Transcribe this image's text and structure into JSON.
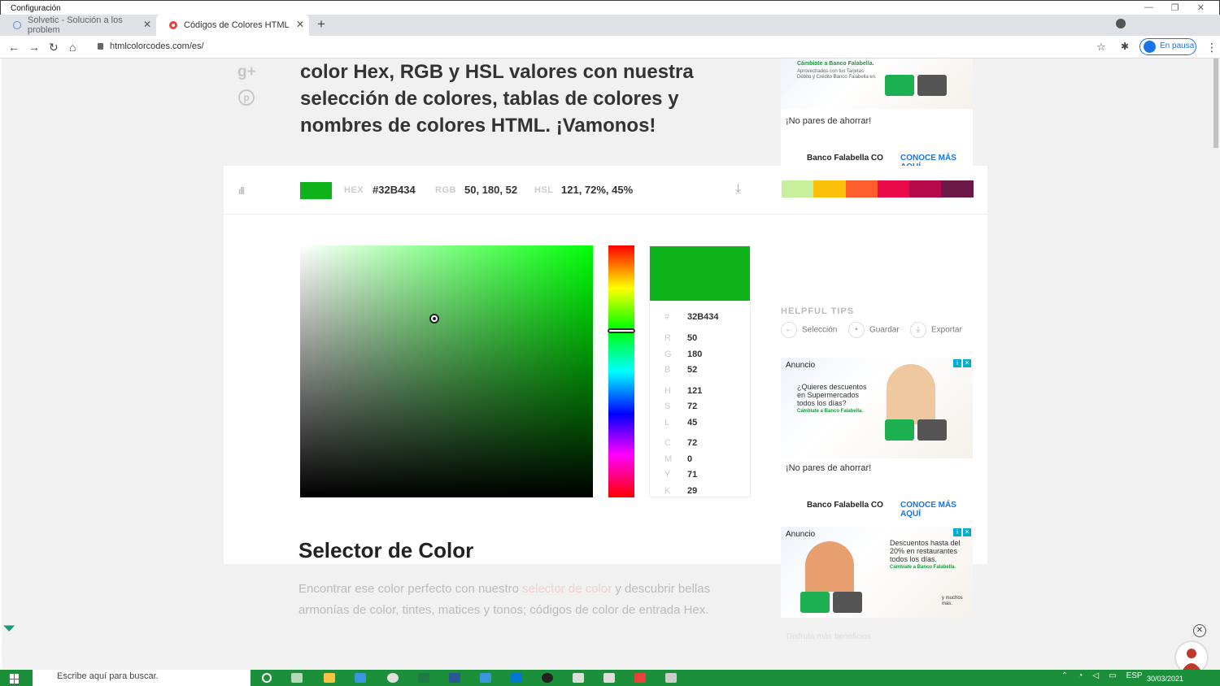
{
  "window": {
    "title": "Configuración"
  },
  "tabs": [
    {
      "label": "Solvetic - Solución a los problem"
    },
    {
      "label": "Códigos de Colores HTML"
    }
  ],
  "address": {
    "url": "htmlcolorcodes.com/es/"
  },
  "profile": {
    "label": "En pausa"
  },
  "page": {
    "headline_lines": [
      "color Hex, RGB y HSL valores con nuestra",
      "selección de colores, tablas de colores y",
      "nombres de colores HTML. ¡Vamonos!"
    ]
  },
  "color_bar": {
    "hex_label": "HEX",
    "hex_value": "#32B434",
    "rgb_label": "RGB",
    "rgb_value": "50, 180, 52",
    "hsl_label": "HSL",
    "hsl_value": "121, 72%, 45%",
    "swatch": "#0fb31b",
    "palette": [
      "#c6f09c",
      "#fcc20b",
      "#fe5d2e",
      "#ea0a49",
      "#b40a4a",
      "#6b1747"
    ]
  },
  "picker": {
    "hue_level": 0.34,
    "values": [
      {
        "k": "#",
        "v": "32B434"
      },
      {
        "k": "R",
        "v": "50"
      },
      {
        "k": "G",
        "v": "180"
      },
      {
        "k": "B",
        "v": "52"
      },
      {
        "k": "H",
        "v": "121"
      },
      {
        "k": "S",
        "v": "72"
      },
      {
        "k": "L",
        "v": "45"
      },
      {
        "k": "C",
        "v": "72"
      },
      {
        "k": "M",
        "v": "0"
      },
      {
        "k": "Y",
        "v": "71"
      },
      {
        "k": "K",
        "v": "29"
      }
    ]
  },
  "tips": {
    "title": "HELPFUL TIPS",
    "items": [
      "Selección",
      "Guardar",
      "Exportar"
    ]
  },
  "ads": {
    "top": {
      "tagline": "¡No pares de ahorrar!",
      "brand": "Banco Falabella CO",
      "cta": "CONOCE MÁS AQUÍ",
      "small1": "Cámbiate a Banco Falabella.",
      "small2": "Aprovechados con tus Tarjetas",
      "small3": "Débito y Crédito Banco Falabella en."
    },
    "mid": {
      "anuncio": "Anuncio",
      "headline": "¿Quieres descuentos en Supermercados todos los días?",
      "small": "Cámbiate a Banco Falabella.",
      "tagline": "¡No pares de ahorrar!",
      "brand": "Banco Falabella CO",
      "cta": "CONOCE MÁS AQUÍ"
    },
    "bottom": {
      "anuncio": "Anuncio",
      "headline": "Descuentos hasta del 20% en restaurantes todos los días.",
      "small": "Cámbiate a Banco Falabella.",
      "more": "y muchos más.",
      "footer": "Disfruta más beneficios"
    }
  },
  "section": {
    "title": "Selector de Color",
    "p_pre": "Encontrar ese color perfecto con nuestro ",
    "p_link": "selector de color",
    "p_post": " y descubrir bellas armonías de color, tintes, matices y tonos; códigos de color de entrada Hex."
  },
  "taskbar": {
    "search": "Escribe aquí para buscar.",
    "lang": "ESP",
    "date": "30/03/2021"
  }
}
